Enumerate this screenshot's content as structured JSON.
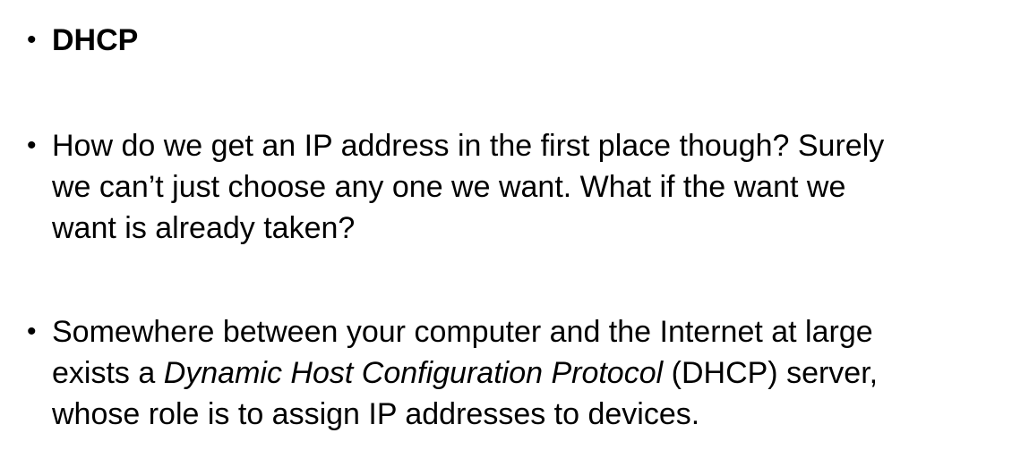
{
  "slide": {
    "bullets": [
      {
        "marker": "•",
        "text": "DHCP"
      },
      {
        "marker": "•",
        "lines": [
          "How do we get an IP address in the first place though? Surely",
          "we can’t just choose any one we want. What if the want we",
          "want is already taken?"
        ]
      },
      {
        "marker": "•",
        "line1": "Somewhere between your computer and the Internet at large",
        "line2_pre": "exists a ",
        "line2_italic": "Dynamic Host Configuration Protocol",
        "line2_post": " (DHCP) server,",
        "line3": "whose role is to assign IP addresses to devices."
      }
    ]
  }
}
